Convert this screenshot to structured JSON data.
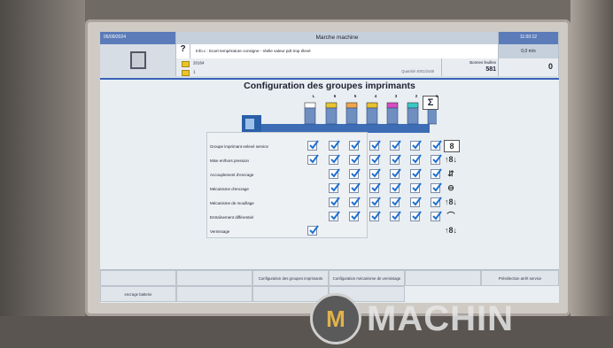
{
  "header": {
    "date": "05/09/2024",
    "time": "11:00:12",
    "title": "Marche machine",
    "help": "?",
    "message": "Info.c : Ecart température consigne - réelle valeur pdt trop élevé",
    "job_id": "20164",
    "job_sub": "1",
    "job_status": "Quantité 4001/2448",
    "bonnes_label": "Bonnes feuilles",
    "bonnes_value": "581",
    "speed": "0,0 m/s",
    "counter": "0"
  },
  "config": {
    "title": "Configuration des groupes imprimants",
    "units": [
      "L",
      "6",
      "5",
      "4",
      "3",
      "2",
      "1"
    ],
    "unit_colors": [
      "#ffffff",
      "#e9c52d",
      "#f2a54a",
      "#e8c12a",
      "#d84cc4",
      "#38c9c4",
      "#222222"
    ],
    "rows": [
      {
        "label": "Groupe imprimant enlevé service",
        "checked": [
          1,
          1,
          1,
          1,
          1,
          1,
          1
        ],
        "icon": "8"
      },
      {
        "label": "Mise en/hors pression",
        "checked": [
          1,
          1,
          1,
          1,
          1,
          1,
          1
        ],
        "icon": "↑8↓"
      },
      {
        "label": "Accouplement d'encrage",
        "checked": [
          0,
          1,
          1,
          1,
          1,
          1,
          1
        ],
        "icon": "⇵"
      },
      {
        "label": "Mécanisme d'encrage",
        "checked": [
          0,
          1,
          1,
          1,
          1,
          1,
          1
        ],
        "icon": "⊖"
      },
      {
        "label": "Mécanisme de mouillage",
        "checked": [
          0,
          1,
          1,
          1,
          1,
          1,
          1
        ],
        "icon": "↑8↓"
      },
      {
        "label": "Entraînement différentiel",
        "checked": [
          0,
          1,
          1,
          1,
          1,
          1,
          1
        ],
        "icon": "⌒"
      },
      {
        "label": "Vernissage",
        "checked": [
          1,
          0,
          0,
          0,
          0,
          0,
          0
        ],
        "icon": "↑8↓"
      }
    ]
  },
  "footer": {
    "buttons": [
      {
        "label": ""
      },
      {
        "label": ""
      },
      {
        "label": "Configuration des groupes imprimants"
      },
      {
        "label": "Configuration mécanisme de vernissage"
      },
      {
        "label": ""
      },
      {
        "label": "Présélection arrêt service"
      },
      {
        "label": "encrage batterie"
      },
      {
        "label": ""
      },
      {
        "label": ""
      },
      {
        "label": ""
      }
    ]
  },
  "watermark": {
    "text": "MACHIN",
    "logo": "M"
  }
}
